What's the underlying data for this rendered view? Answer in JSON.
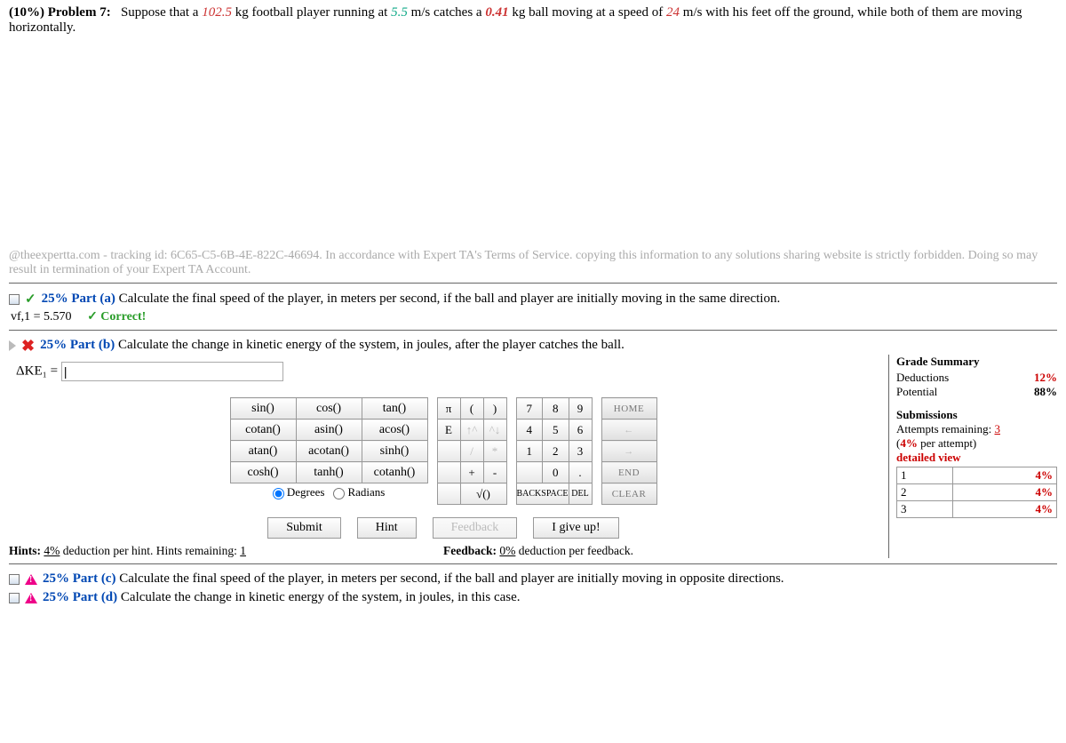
{
  "problem": {
    "percent": "(10%)",
    "label": "Problem 7:",
    "prefix": "Suppose that a ",
    "mass_player": "102.5",
    "seg1": " kg football player running at ",
    "speed_player": "5.5",
    "seg2": " m/s catches a ",
    "mass_ball": "0.41",
    "seg3": " kg ball moving at a speed of ",
    "speed_ball": "24",
    "seg4": " m/s with his feet off the ground, while both of them are moving horizontally."
  },
  "tracking": "@theexpertta.com - tracking id: 6C65-C5-6B-4E-822C-46694. In accordance with Expert TA's Terms of Service. copying this information to any solutions sharing website is strictly forbidden. Doing so may result in termination of your Expert TA Account.",
  "part_a": {
    "title": "25% Part (a)",
    "text": "  Calculate the final speed of the player, in meters per second, if the ball and player are initially moving in the same direction.",
    "answer_lhs": "vf,1 = 5.570",
    "correct": "✓ Correct!"
  },
  "part_b": {
    "title": "25% Part (b)",
    "text": "  Calculate the change in kinetic energy of the system, in joules, after the player catches the ball.",
    "eq_lhs": "ΔKE₁ = "
  },
  "keypad": {
    "funcs": [
      [
        "sin()",
        "cos()",
        "tan()"
      ],
      [
        "cotan()",
        "asin()",
        "acos()"
      ],
      [
        "atan()",
        "acotan()",
        "sinh()"
      ],
      [
        "cosh()",
        "tanh()",
        "cotanh()"
      ]
    ],
    "deg": "Degrees",
    "rad": "Radians",
    "mid": [
      [
        "π",
        "(",
        ")"
      ],
      [
        "E",
        "↑^",
        "^↓"
      ],
      [
        "",
        "/",
        "*"
      ],
      [
        "",
        "+",
        "-"
      ],
      [
        "",
        "√()",
        ""
      ]
    ],
    "nums": [
      [
        "7",
        "8",
        "9"
      ],
      [
        "4",
        "5",
        "6"
      ],
      [
        "1",
        "2",
        "3"
      ],
      [
        "",
        "0",
        "."
      ],
      [
        "BACKSPACE",
        "",
        "DEL"
      ]
    ],
    "nav": [
      "HOME",
      "←",
      "→",
      "END",
      "CLEAR"
    ],
    "backspace": "BACKSPACE",
    "del": "DEL"
  },
  "actions": {
    "submit": "Submit",
    "hint": "Hint",
    "feedback": "Feedback",
    "giveup": "I give up!"
  },
  "hints": {
    "pre": "Hints: ",
    "pct": "4%",
    "mid": " deduction per hint. Hints remaining: ",
    "rem": "1"
  },
  "feedback": {
    "pre": "Feedback: ",
    "pct": "0%",
    "post": " deduction per feedback."
  },
  "grade": {
    "title": "Grade Summary",
    "rows": [
      [
        "Deductions",
        "12%"
      ],
      [
        "Potential",
        "88%"
      ]
    ],
    "sub_title": "Submissions",
    "attempts_pre": "Attempts remaining: ",
    "attempts_n": "3",
    "per_attempt": "(4% per attempt)",
    "detailed": "detailed view",
    "attempts_list": [
      [
        "1",
        "4%"
      ],
      [
        "2",
        "4%"
      ],
      [
        "3",
        "4%"
      ]
    ]
  },
  "part_c": {
    "title": "25% Part (c)",
    "text": "  Calculate the final speed of the player, in meters per second, if the ball and player are initially moving in opposite directions."
  },
  "part_d": {
    "title": "25% Part (d)",
    "text": "  Calculate the change in kinetic energy of the system, in joules, in this case."
  }
}
